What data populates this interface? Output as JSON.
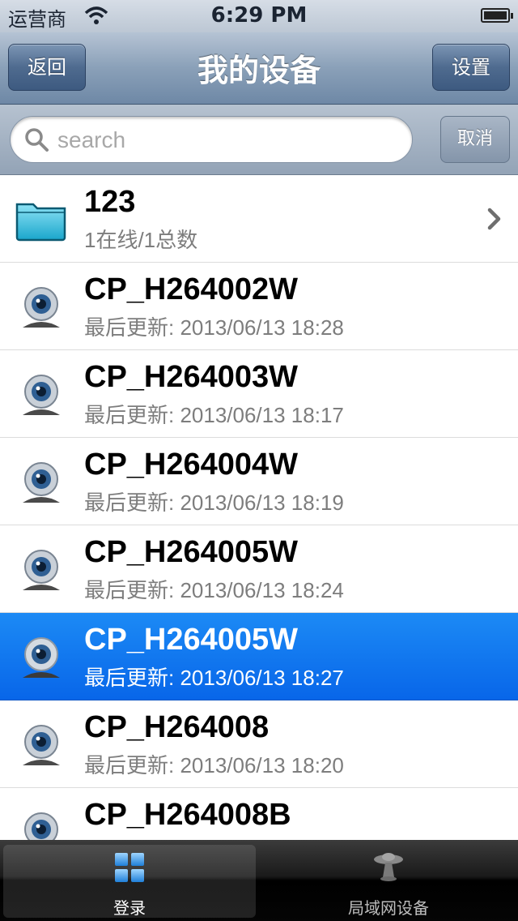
{
  "status_bar": {
    "carrier": "运营商",
    "time": "6:29 PM"
  },
  "nav": {
    "title": "我的设备",
    "back_label": "返回",
    "settings_label": "设置"
  },
  "search": {
    "placeholder": "search",
    "cancel_label": "取消"
  },
  "items": [
    {
      "type": "folder",
      "title": "123",
      "subtitle": "1在线/1总数"
    },
    {
      "type": "camera",
      "title": "CP_H264002W",
      "subtitle": "最后更新: 2013/06/13 18:28"
    },
    {
      "type": "camera",
      "title": "CP_H264003W",
      "subtitle": "最后更新: 2013/06/13 18:17"
    },
    {
      "type": "camera",
      "title": "CP_H264004W",
      "subtitle": "最后更新: 2013/06/13 18:19"
    },
    {
      "type": "camera",
      "title": "CP_H264005W",
      "subtitle": "最后更新: 2013/06/13 18:24"
    },
    {
      "type": "camera",
      "title": "CP_H264005W",
      "subtitle": "最后更新: 2013/06/13 18:27",
      "selected": true
    },
    {
      "type": "camera",
      "title": "CP_H264008",
      "subtitle": "最后更新: 2013/06/13 18:20"
    },
    {
      "type": "camera",
      "title": "CP_H264008B",
      "subtitle": ""
    }
  ],
  "tabs": {
    "login": "登录",
    "lan": "局域网设备"
  },
  "colors": {
    "nav_accent": "#6e88a6",
    "selected_row": "#0866e9"
  },
  "icons": {
    "status": [
      "wifi-icon",
      "battery-icon"
    ],
    "search": "search-icon",
    "rows": [
      "folder-icon",
      "webcam-icon",
      "chevron-right-icon"
    ],
    "tabs": [
      "grid-icon",
      "lan-device-icon"
    ]
  }
}
